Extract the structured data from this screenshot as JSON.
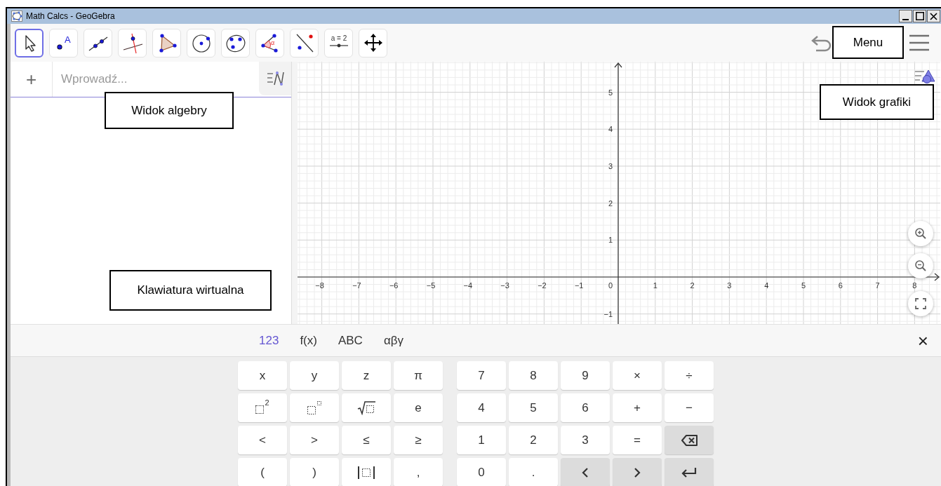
{
  "window": {
    "title": "Math Calcs - GeoGebra"
  },
  "toolbar": {
    "tools": [
      {
        "kind": "move",
        "selected": true
      },
      {
        "kind": "point",
        "label": "A",
        "selected": false
      },
      {
        "kind": "line",
        "selected": false
      },
      {
        "kind": "perpendicular",
        "selected": false
      },
      {
        "kind": "polygon",
        "selected": false
      },
      {
        "kind": "circle",
        "selected": false
      },
      {
        "kind": "conic",
        "selected": false
      },
      {
        "kind": "angle",
        "label": "α",
        "selected": false
      },
      {
        "kind": "reflect",
        "selected": false
      },
      {
        "kind": "slider",
        "label": "a = 2",
        "selected": false
      },
      {
        "kind": "pan",
        "selected": false
      }
    ]
  },
  "algebra": {
    "add_button": "+",
    "input": {
      "placeholder": "Wprowadź..."
    }
  },
  "graphics": {
    "x_labels": [
      "−8",
      "−7",
      "−6",
      "−5",
      "−4",
      "−3",
      "−2",
      "−1",
      "1",
      "2",
      "3",
      "4",
      "5",
      "6",
      "7",
      "8"
    ],
    "origin_label": "0",
    "y_labels": [
      "5",
      "4",
      "3",
      "2",
      "1",
      "−1"
    ]
  },
  "keyboard": {
    "tabs": [
      {
        "label": "123",
        "selected": true
      },
      {
        "label": "f(x)",
        "selected": false
      },
      {
        "label": "ABC",
        "selected": false
      },
      {
        "label": "αβγ",
        "selected": false
      }
    ],
    "close": "×",
    "left_keys": [
      {
        "kind": "text",
        "label": "x"
      },
      {
        "kind": "text",
        "label": "y"
      },
      {
        "kind": "text",
        "label": "z"
      },
      {
        "kind": "text",
        "label": "π"
      },
      {
        "kind": "squared",
        "label": "2"
      },
      {
        "kind": "power"
      },
      {
        "kind": "sqrt"
      },
      {
        "kind": "text",
        "label": "e"
      },
      {
        "kind": "text",
        "label": "<"
      },
      {
        "kind": "text",
        "label": ">"
      },
      {
        "kind": "text",
        "label": "≤"
      },
      {
        "kind": "text",
        "label": "≥"
      },
      {
        "kind": "text",
        "label": "("
      },
      {
        "kind": "text",
        "label": ")"
      },
      {
        "kind": "abs"
      },
      {
        "kind": "text",
        "label": ","
      }
    ],
    "right_keys": [
      {
        "kind": "text",
        "label": "7"
      },
      {
        "kind": "text",
        "label": "8"
      },
      {
        "kind": "text",
        "label": "9"
      },
      {
        "kind": "text",
        "label": "×"
      },
      {
        "kind": "text",
        "label": "÷"
      },
      {
        "kind": "text",
        "label": "4"
      },
      {
        "kind": "text",
        "label": "5"
      },
      {
        "kind": "text",
        "label": "6"
      },
      {
        "kind": "text",
        "label": "+"
      },
      {
        "kind": "text",
        "label": "−"
      },
      {
        "kind": "text",
        "label": "1"
      },
      {
        "kind": "text",
        "label": "2"
      },
      {
        "kind": "text",
        "label": "3"
      },
      {
        "kind": "text",
        "label": "="
      },
      {
        "kind": "backspace"
      },
      {
        "kind": "text",
        "label": "0"
      },
      {
        "kind": "text",
        "label": "."
      },
      {
        "kind": "left"
      },
      {
        "kind": "right"
      },
      {
        "kind": "enter"
      }
    ]
  },
  "annotations": [
    {
      "text": "Menu"
    },
    {
      "text": "Widok algebry"
    },
    {
      "text": "Widok grafiki"
    },
    {
      "text": "Klawiatura wirtualna"
    }
  ]
}
